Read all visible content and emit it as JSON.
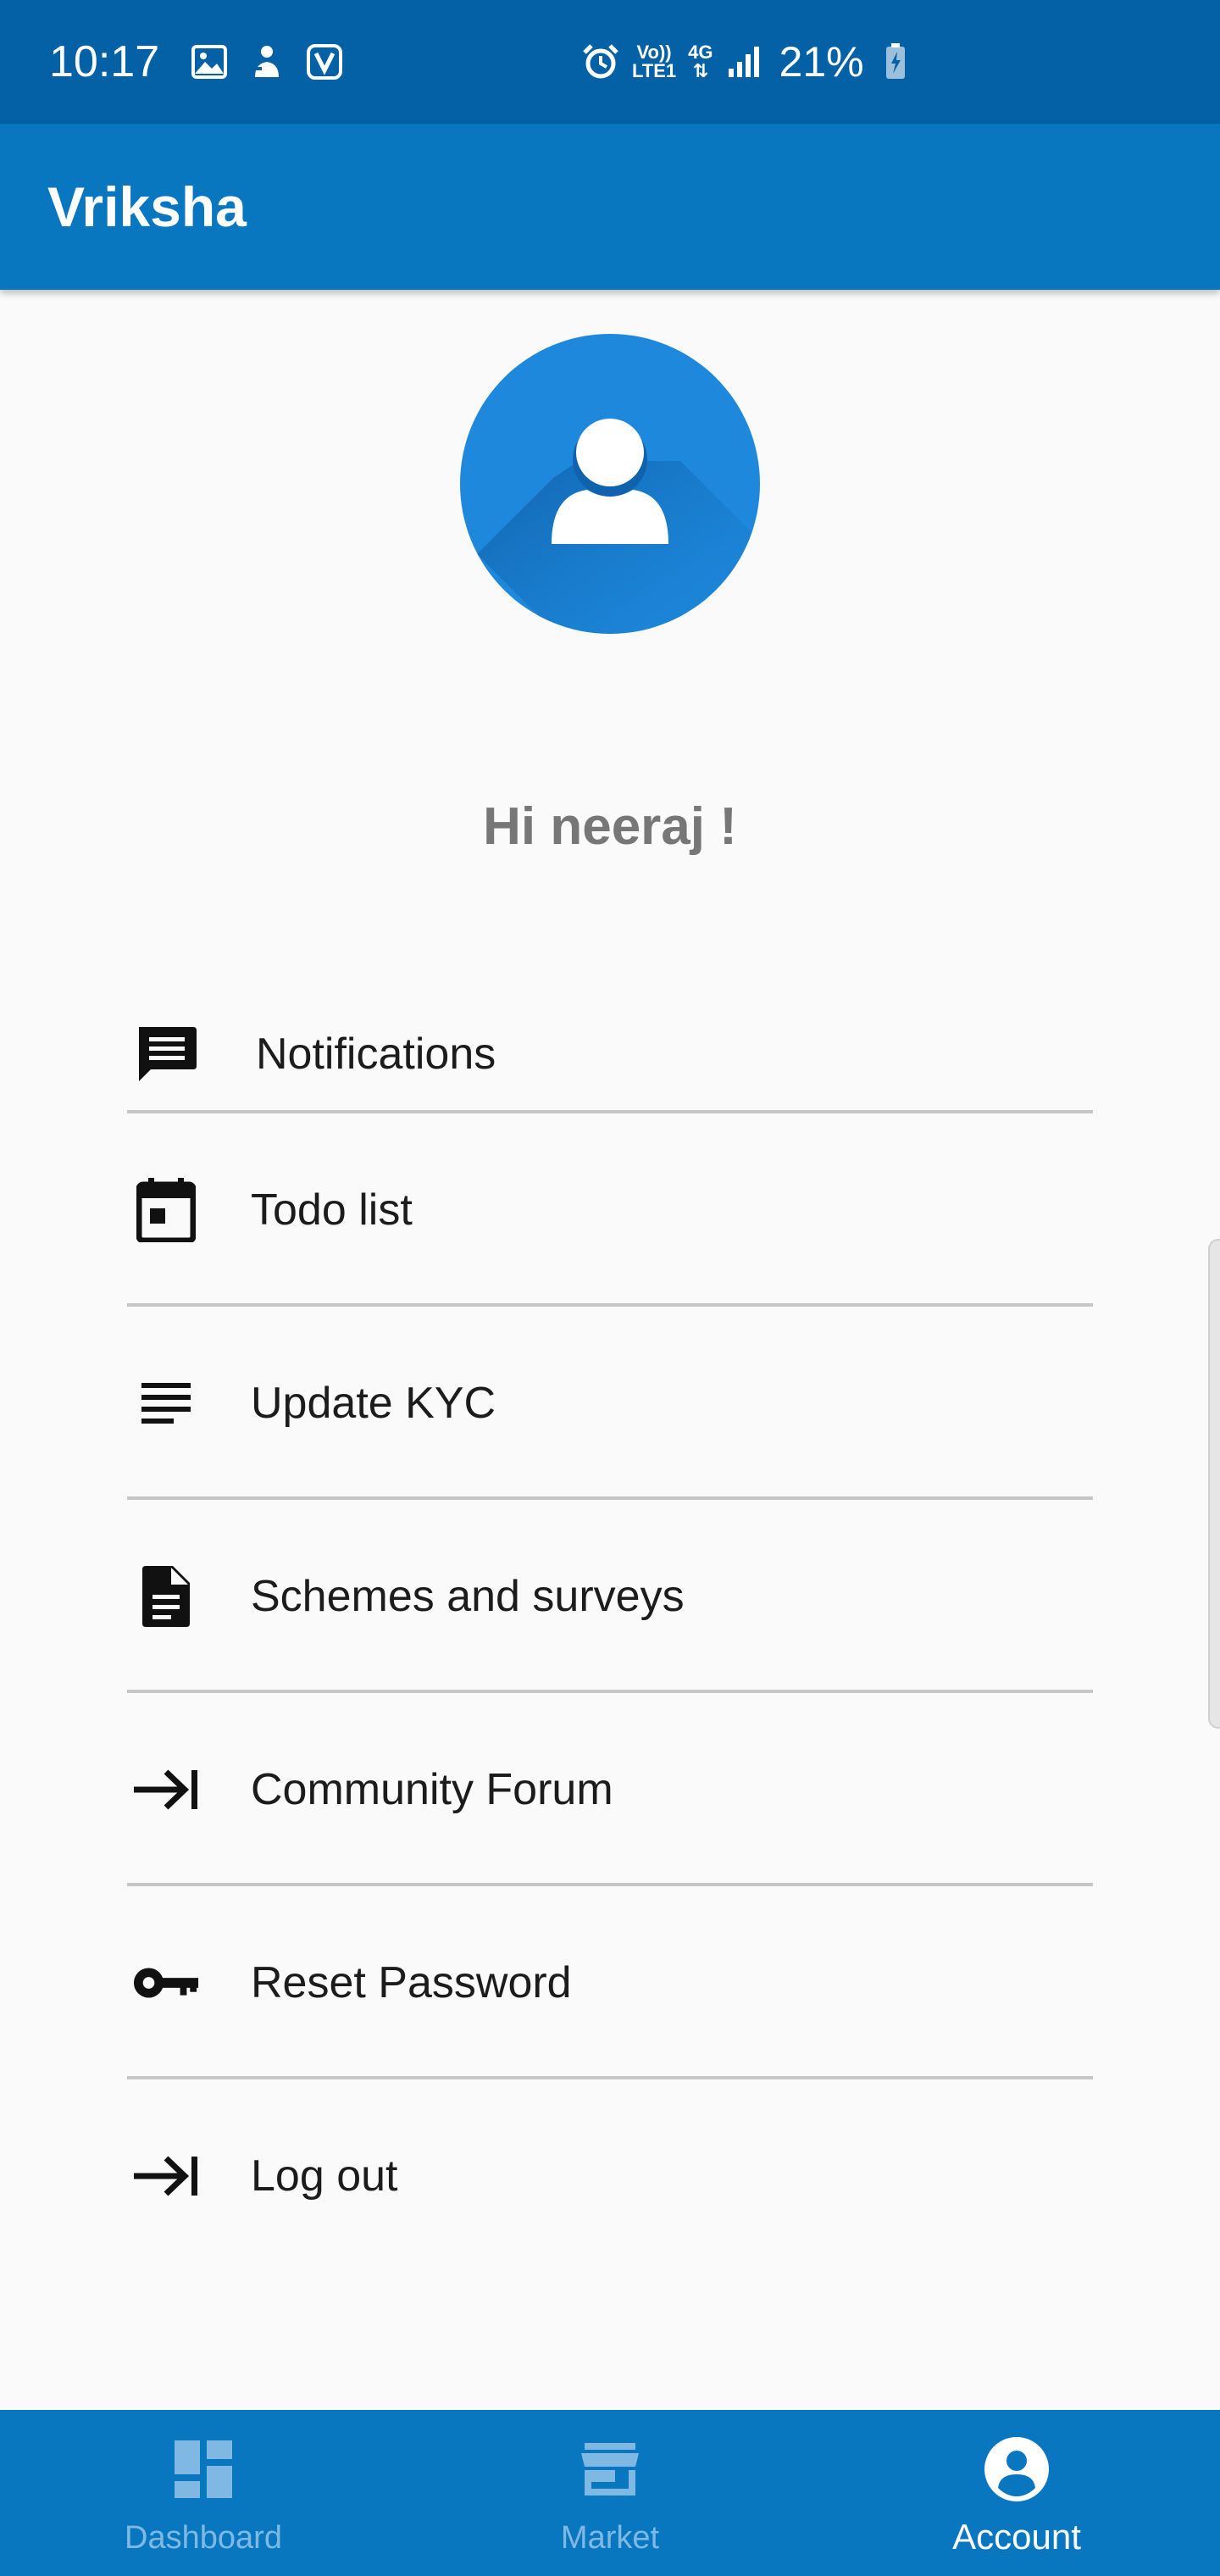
{
  "status_bar": {
    "time": "10:17",
    "network_top": "Vo))",
    "network_bottom": "LTE1",
    "signal_type": "4G",
    "battery_percent": "21%",
    "icons": [
      "gallery-icon",
      "notification-icon",
      "saavn-icon",
      "alarm-icon",
      "signal-icon",
      "battery-charging-icon"
    ]
  },
  "app_bar": {
    "title": "Vriksha"
  },
  "profile": {
    "greeting": "Hi neeraj !",
    "avatar_color": "#1e88dc"
  },
  "menu": {
    "items": [
      {
        "label": "Notifications",
        "icon": "message-icon"
      },
      {
        "label": "Todo list",
        "icon": "calendar-icon"
      },
      {
        "label": "Update KYC",
        "icon": "lines-icon"
      },
      {
        "label": "Schemes and surveys",
        "icon": "document-icon"
      },
      {
        "label": "Community Forum",
        "icon": "arrow-to-line-icon"
      },
      {
        "label": "Reset Password",
        "icon": "key-icon"
      },
      {
        "label": "Log out",
        "icon": "arrow-to-line-icon"
      }
    ]
  },
  "bottom_nav": {
    "items": [
      {
        "label": "Dashboard",
        "icon": "dashboard-icon",
        "active": false
      },
      {
        "label": "Market",
        "icon": "store-icon",
        "active": false
      },
      {
        "label": "Account",
        "icon": "account-circle-icon",
        "active": true
      }
    ]
  },
  "colors": {
    "status_bar": "#0561a6",
    "primary": "#0877c0",
    "background": "#fafafa",
    "nav_inactive": "#7fb8e3",
    "nav_active": "#ffffff"
  }
}
